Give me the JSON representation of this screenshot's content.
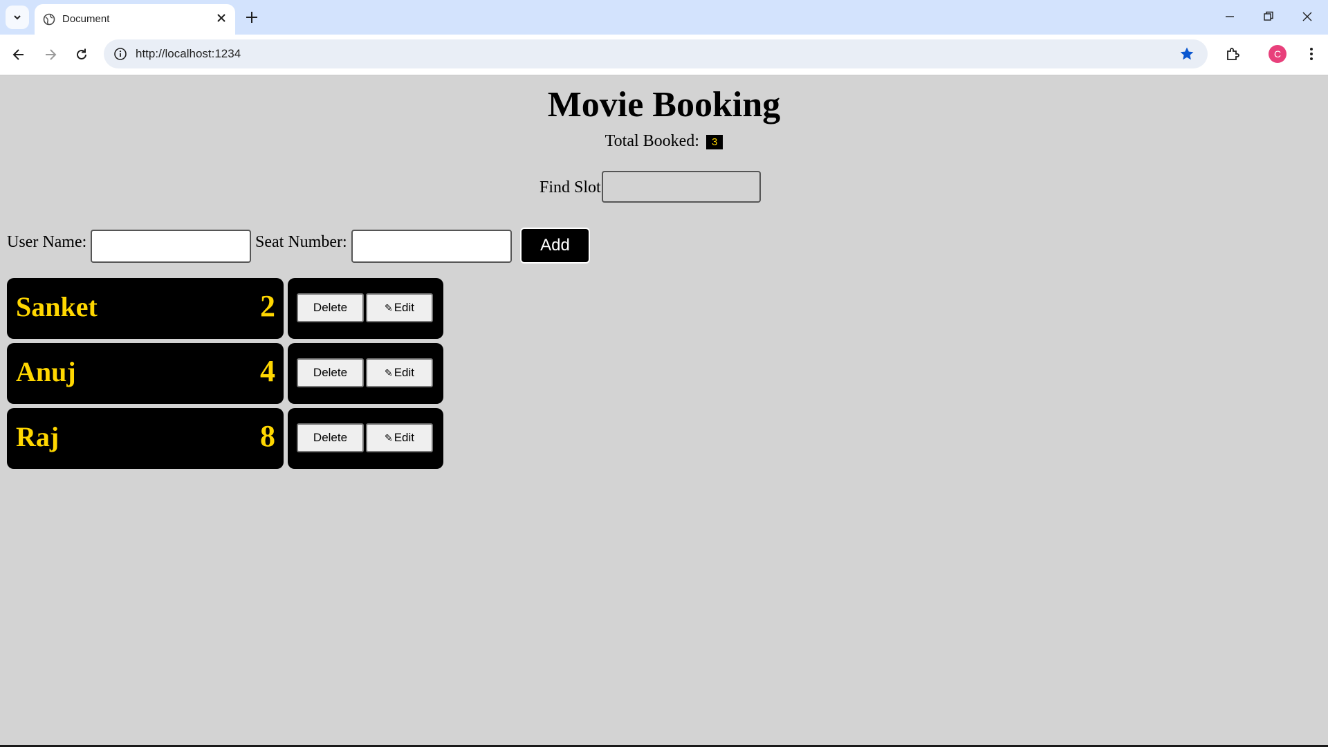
{
  "browser": {
    "tab_title": "Document",
    "url": "http://localhost:1234",
    "profile_initial": "C"
  },
  "app": {
    "title": "Movie Booking",
    "total_label": "Total Booked:",
    "total_count": "3",
    "find_label": "Find Slot:",
    "find_value": "",
    "username_label": "User Name:",
    "username_value": "",
    "seat_label": "Seat Number:",
    "seat_value": "",
    "add_label": "Add",
    "delete_label": "Delete",
    "edit_label": "Edit",
    "edit_icon": "✎",
    "bookings": [
      {
        "name": "Sanket",
        "seat": "2"
      },
      {
        "name": "Anuj",
        "seat": "4"
      },
      {
        "name": "Raj",
        "seat": "8"
      }
    ]
  },
  "colors": {
    "page_bg": "#d3d3d3",
    "card_bg": "#000000",
    "card_text": "#ffd700",
    "tabbar_bg": "#d3e3fd"
  }
}
